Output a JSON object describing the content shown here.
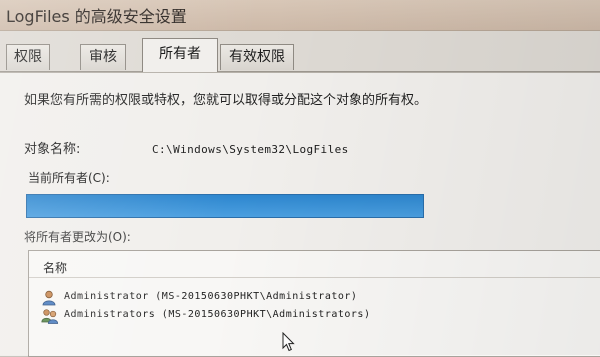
{
  "window": {
    "title": "LogFiles 的高级安全设置"
  },
  "tabs": [
    {
      "label": "权限"
    },
    {
      "label": "审核"
    },
    {
      "label": "所有者"
    },
    {
      "label": "有效权限"
    }
  ],
  "owner_tab": {
    "intro": "如果您有所需的权限或特权，您就可以取得或分配这个对象的所有权。",
    "object_name_label": "对象名称:",
    "object_name_value": "C:\\Windows\\System32\\LogFiles",
    "current_owner_label": "当前所有者(C):",
    "current_owner_value": "",
    "change_owner_label": "将所有者更改为(O):",
    "list_header": "名称",
    "owner_candidates": [
      {
        "label": "Administrator (MS-20150630PHKT\\Administrator)",
        "icon": "user-icon"
      },
      {
        "label": "Administrators (MS-20150630PHKT\\Administrators)",
        "icon": "group-icon"
      }
    ]
  }
}
